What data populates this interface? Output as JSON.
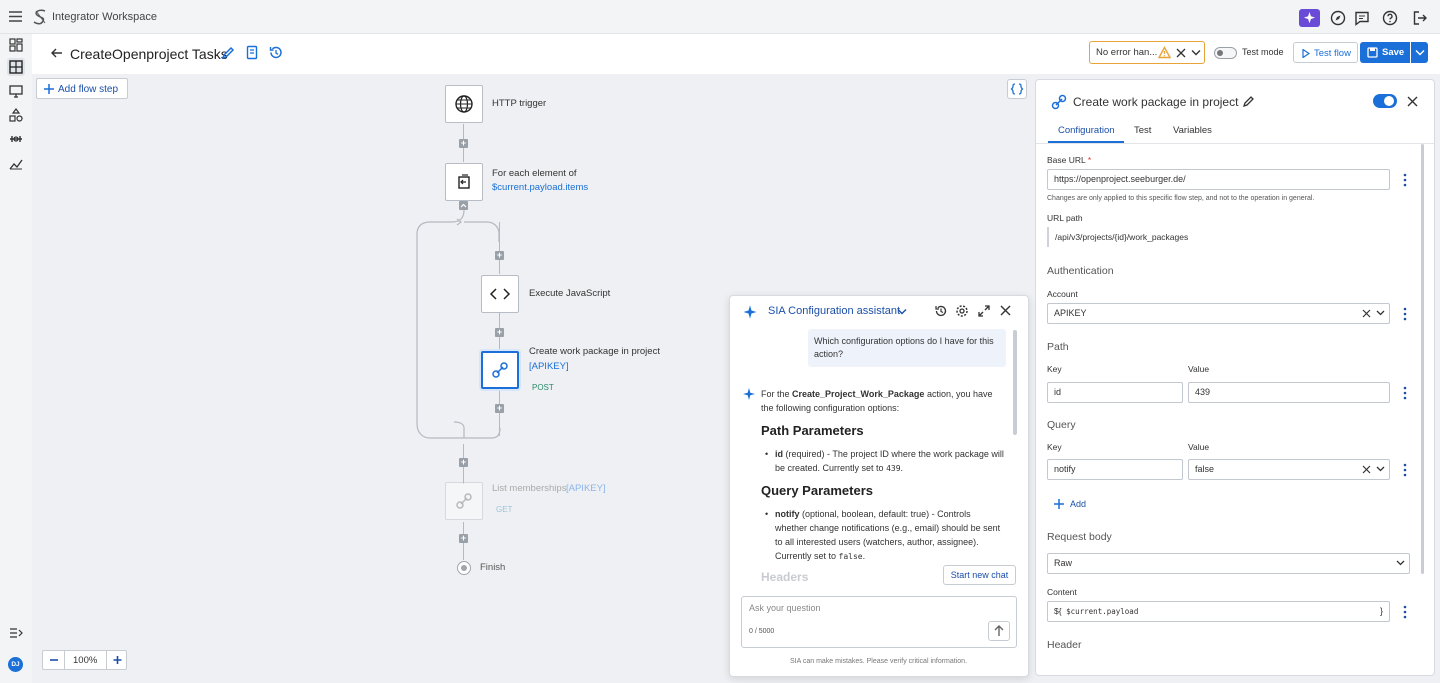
{
  "app": {
    "title": "Integrator Workspace"
  },
  "header": {
    "flow_title": "CreateOpenproject Tasks",
    "error_filter": "No error han...",
    "test_mode_label": "Test mode",
    "test_flow_label": "Test flow",
    "save_label": "Save"
  },
  "canvas": {
    "add_step_label": "Add flow step",
    "zoom": "100%",
    "nodes": {
      "http": {
        "label": "HTTP trigger"
      },
      "foreach": {
        "label": "For each element of",
        "expr": "$current.payload.items"
      },
      "js": {
        "label": "Execute JavaScript"
      },
      "create": {
        "label": "Create work package in project",
        "account": "[APIKEY]",
        "method": "POST"
      },
      "list": {
        "label": "List memberships",
        "account": "[APIKEY]",
        "method": "GET"
      },
      "finish": {
        "label": "Finish"
      }
    }
  },
  "sia": {
    "title": "SIA Configuration assistant",
    "user_msg": "Which configuration options do I have for this action?",
    "reply_pre": "For the ",
    "reply_action": "Create_Project_Work_Package",
    "reply_post": " action, you have the following configuration options:",
    "h_path": "Path Parameters",
    "path_name": "id",
    "path_desc": " (required) - The project ID where the work package will be created. Currently set to ",
    "path_val": "439",
    "h_query": "Query Parameters",
    "query_name": "notify",
    "query_desc": " (optional, boolean, default: true) - Controls whether change notifications (e.g., email) should be sent to all interested users (watchers, author, assignee). Currently set to ",
    "query_val": "false",
    "h_headers": "Headers",
    "new_chat": "Start new chat",
    "placeholder": "Ask your question",
    "counter": "0 / 5000",
    "disclaimer": "SIA can make mistakes. Please verify critical information."
  },
  "panel": {
    "title": "Create work package in project",
    "tabs": [
      "Configuration",
      "Test",
      "Variables"
    ],
    "base_url_label": "Base URL",
    "base_url": "https://openproject.seeburger.de/",
    "base_url_hint": "Changes are only applied to this specific flow step, and not to the operation in general.",
    "url_path_label": "URL path",
    "url_path": "/api/v3/projects/{id}/work_packages",
    "auth_title": "Authentication",
    "account_label": "Account",
    "account": "APIKEY",
    "path_title": "Path",
    "key_label": "Key",
    "value_label": "Value",
    "path_key": "id",
    "path_value": "439",
    "query_title": "Query",
    "query_key": "notify",
    "query_value": "false",
    "add_label": "Add",
    "body_title": "Request body",
    "body_type": "Raw",
    "content_label": "Content",
    "content_prefix": "${",
    "content_value": "$current.payload",
    "content_suffix": "}",
    "header_title": "Header"
  },
  "user": {
    "initials": "DJ"
  },
  "colors": {
    "accent": "#1a6fd8",
    "save": "#1a6fd8",
    "warning": "#e8a33b"
  }
}
